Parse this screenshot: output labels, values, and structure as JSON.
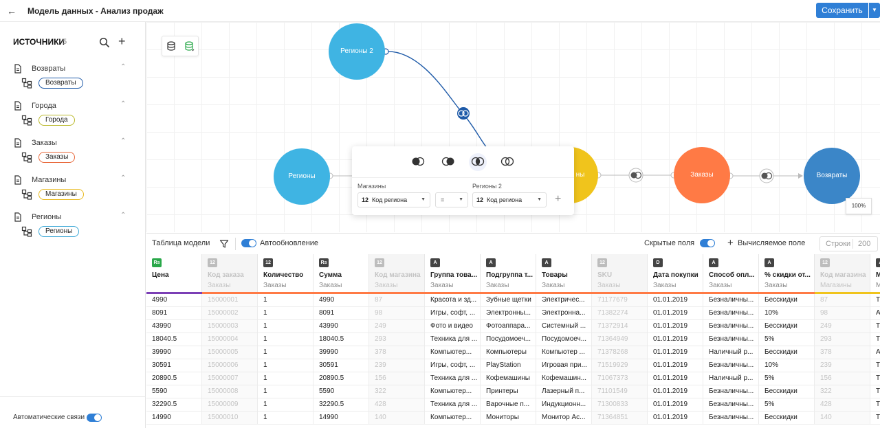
{
  "header": {
    "title": "Модель данных - Анализ продаж",
    "save_label": "Сохранить"
  },
  "sidebar": {
    "title": "ИСТОЧНИКИ",
    "count": "5",
    "sources": [
      {
        "name": "Возвраты",
        "table": "Возвраты",
        "color": "#1e5aa8"
      },
      {
        "name": "Города",
        "table": "Города",
        "color": "#b9b82a"
      },
      {
        "name": "Заказы",
        "table": "Заказы",
        "color": "#e8683a"
      },
      {
        "name": "Магазины",
        "table": "Магазины",
        "color": "#e8b91e"
      },
      {
        "name": "Регионы",
        "table": "Регионы",
        "color": "#3aa7d6"
      }
    ],
    "auto_links_label": "Автоматические связи",
    "auto_links_on": true
  },
  "canvas": {
    "nodes": [
      {
        "label": "Регионы 2",
        "color": "#3fb4e3"
      },
      {
        "label": "Регионы",
        "color": "#3fb4e3"
      },
      {
        "label": "ны",
        "color": "#f0c41c"
      },
      {
        "label": "Заказы",
        "color": "#ff7a45"
      },
      {
        "label": "Возвраты",
        "color": "#3b86c8"
      }
    ],
    "zoom": "100%",
    "join": {
      "left_source": "Магазины",
      "right_source": "Регионы 2",
      "left_field": "Код региона",
      "left_type": "12",
      "operator": "=",
      "right_field": "Код региона",
      "right_type": "12"
    }
  },
  "table_toolbar": {
    "title": "Таблица модели",
    "auto_update": "Автообновление",
    "hidden_fields": "Скрытые поля",
    "calc_field": "Вычисляемое поле",
    "rows_label": "Строки",
    "rows_value": "200"
  },
  "table": {
    "columns": [
      {
        "type": "Rs",
        "name": "Цена",
        "source": "",
        "hidden": false,
        "color": "#7b3fb5",
        "iconColor": "#2aa84a"
      },
      {
        "type": "12",
        "name": "Код заказа",
        "source": "Заказы",
        "hidden": true,
        "color": "#ff7a45",
        "iconColor": "#bdbdbd"
      },
      {
        "type": "12",
        "name": "Количество",
        "source": "Заказы",
        "hidden": false,
        "color": "#ff7a45",
        "iconColor": "#444"
      },
      {
        "type": "Rs",
        "name": "Сумма",
        "source": "Заказы",
        "hidden": false,
        "color": "#ff7a45",
        "iconColor": "#444"
      },
      {
        "type": "12",
        "name": "Код магазина",
        "source": "Заказы",
        "hidden": true,
        "color": "#ff7a45",
        "iconColor": "#bdbdbd"
      },
      {
        "type": "A",
        "name": "Группа това...",
        "source": "Заказы",
        "hidden": false,
        "color": "#ff7a45",
        "iconColor": "#444"
      },
      {
        "type": "A",
        "name": "Подгруппа т...",
        "source": "Заказы",
        "hidden": false,
        "color": "#ff7a45",
        "iconColor": "#444"
      },
      {
        "type": "A",
        "name": "Товары",
        "source": "Заказы",
        "hidden": false,
        "color": "#ff7a45",
        "iconColor": "#444"
      },
      {
        "type": "12",
        "name": "SKU",
        "source": "Заказы",
        "hidden": true,
        "color": "#ff7a45",
        "iconColor": "#bdbdbd"
      },
      {
        "type": "D",
        "name": "Дата покупки",
        "source": "Заказы",
        "hidden": false,
        "color": "#ff7a45",
        "iconColor": "#444"
      },
      {
        "type": "A",
        "name": "Способ опл...",
        "source": "Заказы",
        "hidden": false,
        "color": "#ff7a45",
        "iconColor": "#444"
      },
      {
        "type": "A",
        "name": "% скидки от...",
        "source": "Заказы",
        "hidden": false,
        "color": "#ff7a45",
        "iconColor": "#444"
      },
      {
        "type": "12",
        "name": "Код магазина",
        "source": "Магазины",
        "hidden": true,
        "color": "#f0c41c",
        "iconColor": "#bdbdbd"
      },
      {
        "type": "A",
        "name": "М",
        "source": "М",
        "hidden": false,
        "color": "#f0c41c",
        "iconColor": "#444"
      }
    ],
    "rows": [
      [
        "4990",
        "15000001",
        "1",
        "4990",
        "87",
        "Красота и зд...",
        "Зубные щетки",
        "Электричес...",
        "71177679",
        "01.01.2019",
        "Безналичны...",
        "Бесскидки",
        "87",
        "Т"
      ],
      [
        "8091",
        "15000002",
        "1",
        "8091",
        "98",
        "Игры, софт, ...",
        "Электронны...",
        "Электронна...",
        "71382274",
        "01.01.2019",
        "Безналичны...",
        "10%",
        "98",
        "А"
      ],
      [
        "43990",
        "15000003",
        "1",
        "43990",
        "249",
        "Фото и видео",
        "Фотоаппара...",
        "Системный ...",
        "71372914",
        "01.01.2019",
        "Безналичны...",
        "Бесскидки",
        "249",
        "Т"
      ],
      [
        "18040.5",
        "15000004",
        "1",
        "18040.5",
        "293",
        "Техника для ...",
        "Посудомоеч...",
        "Посудомоеч...",
        "71364949",
        "01.01.2019",
        "Безналичны...",
        "5%",
        "293",
        "Т"
      ],
      [
        "39990",
        "15000005",
        "1",
        "39990",
        "378",
        "Компьютер...",
        "Компьютеры",
        "Компьютер ...",
        "71378268",
        "01.01.2019",
        "Наличный р...",
        "Бесскидки",
        "378",
        "А"
      ],
      [
        "30591",
        "15000006",
        "1",
        "30591",
        "239",
        "Игры, софт, ...",
        "PlayStation",
        "Игровая при...",
        "71519929",
        "01.01.2019",
        "Безналичны...",
        "10%",
        "239",
        "Т"
      ],
      [
        "20890.5",
        "15000007",
        "1",
        "20890.5",
        "156",
        "Техника для ...",
        "Кофемашины",
        "Кофемашин...",
        "71067373",
        "01.01.2019",
        "Наличный р...",
        "5%",
        "156",
        "Т"
      ],
      [
        "5590",
        "15000008",
        "1",
        "5590",
        "322",
        "Компьютер...",
        "Принтеры",
        "Лазерный п...",
        "71101549",
        "01.01.2019",
        "Безналичны...",
        "Бесскидки",
        "322",
        "Т"
      ],
      [
        "32290.5",
        "15000009",
        "1",
        "32290.5",
        "428",
        "Техника для ...",
        "Варочные п...",
        "Индукционн...",
        "71300833",
        "01.01.2019",
        "Безналичны...",
        "5%",
        "428",
        "Т"
      ],
      [
        "14990",
        "15000010",
        "1",
        "14990",
        "140",
        "Компьютер...",
        "Мониторы",
        "Монитор Ас...",
        "71364851",
        "01.01.2019",
        "Безналичны...",
        "Бесскидки",
        "140",
        "Т"
      ]
    ]
  }
}
